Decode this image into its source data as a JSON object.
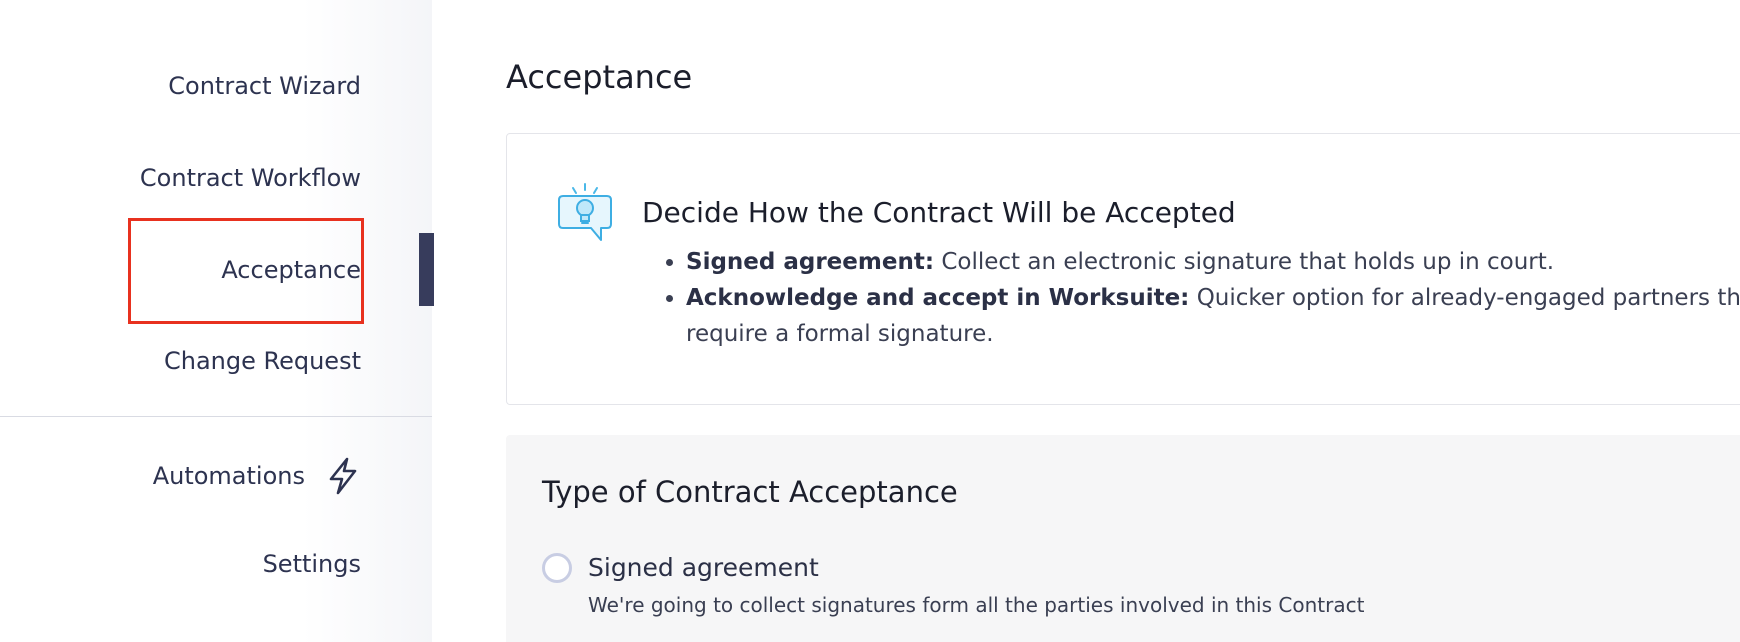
{
  "sidebar": {
    "items": [
      {
        "label": "Contract Wizard"
      },
      {
        "label": "Contract Workflow"
      },
      {
        "label": "Acceptance",
        "active": true
      },
      {
        "label": "Change Request"
      },
      {
        "label": "Automations",
        "icon": "lightning-bolt-icon"
      },
      {
        "label": "Settings"
      }
    ],
    "highlight_color": "#e8311f",
    "active_indicator_color": "#373c5c"
  },
  "main": {
    "title": "Acceptance",
    "info_card": {
      "icon": "lightbulb-speech-icon",
      "heading": "Decide How the Contract Will be Accepted",
      "bullets": [
        {
          "term": "Signed agreement:",
          "text": " Collect an electronic signature that holds up in court."
        },
        {
          "term": "Acknowledge and accept in Worksuite:",
          "text": " Quicker option for already-engaged partners that may no require a formal signature."
        }
      ]
    },
    "acceptance_type": {
      "heading": "Type of Contract Acceptance",
      "options": [
        {
          "label": "Signed agreement",
          "description": "We're going to collect signatures form all the parties involved in this Contract",
          "selected": false
        }
      ]
    }
  }
}
